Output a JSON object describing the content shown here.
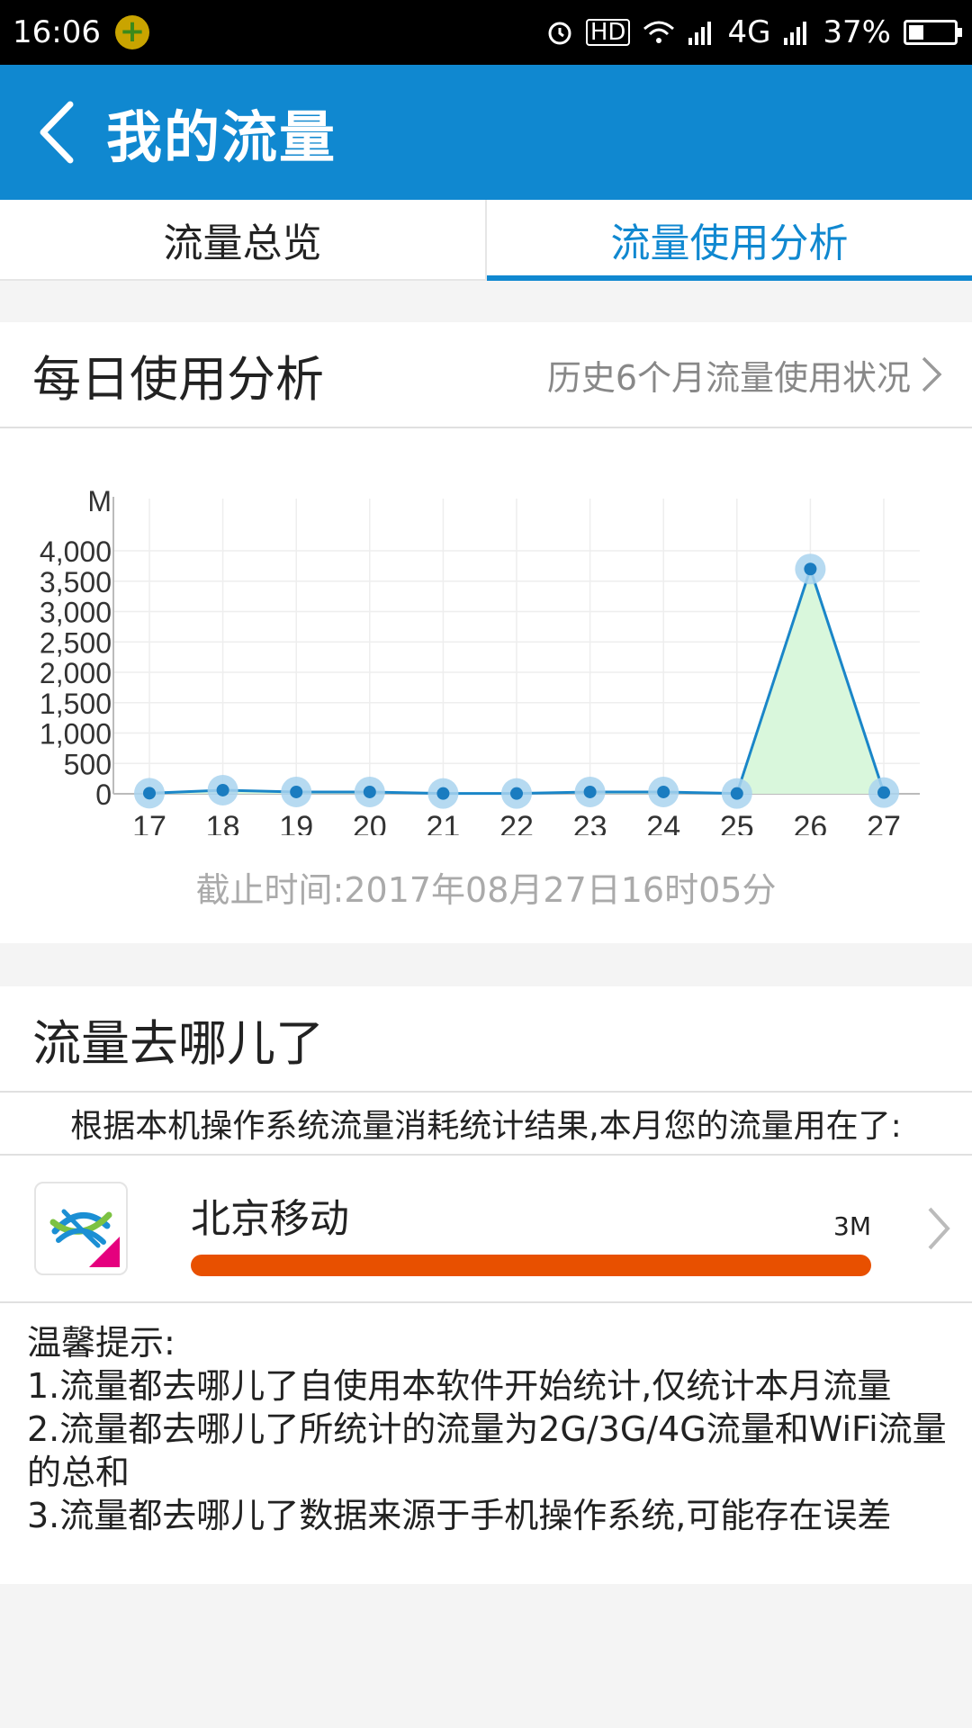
{
  "status_bar": {
    "time": "16:06",
    "network": "4G",
    "battery": "37%",
    "hd": "HD"
  },
  "app_bar": {
    "title": "我的流量"
  },
  "tabs": [
    {
      "label": "流量总览",
      "active": false
    },
    {
      "label": "流量使用分析",
      "active": true
    }
  ],
  "daily": {
    "title": "每日使用分析",
    "history_link": "历史6个月流量使用状况",
    "cutoff": "截止时间:2017年08月27日16时05分"
  },
  "chart_data": {
    "type": "area",
    "title": "",
    "ylabel": "M",
    "xlabel": "",
    "x": [
      "17",
      "18",
      "19",
      "20",
      "21",
      "22",
      "23",
      "24",
      "25",
      "26",
      "27"
    ],
    "values": [
      10,
      60,
      30,
      30,
      5,
      5,
      30,
      30,
      5,
      3700,
      20
    ],
    "ylim": [
      0,
      4000
    ],
    "yticks": [
      "0",
      "500",
      "1,000",
      "1,500",
      "2,000",
      "2,500",
      "3,000",
      "3,500",
      "4,000"
    ],
    "line_color": "#1a86c8",
    "fill_color": "#d9f7dc",
    "grid": true
  },
  "where": {
    "title": "流量去哪儿了",
    "summary": "根据本机操作系统流量消耗统计结果,本月您的流量用在了:",
    "apps": [
      {
        "name": "北京移动",
        "usage": "3M",
        "fraction": 1.0,
        "bar_color": "#e85000",
        "logo_label": "北京"
      }
    ]
  },
  "tips": {
    "heading": "温馨提示:",
    "lines": [
      "1.流量都去哪儿了自使用本软件开始统计,仅统计本月流量",
      "2.流量都去哪儿了所统计的流量为2G/3G/4G流量和WiFi流量的总和",
      "3.流量都去哪儿了数据来源于手机操作系统,可能存在误差"
    ]
  },
  "colors": {
    "primary": "#1088d0",
    "accent_bar": "#e85000"
  }
}
